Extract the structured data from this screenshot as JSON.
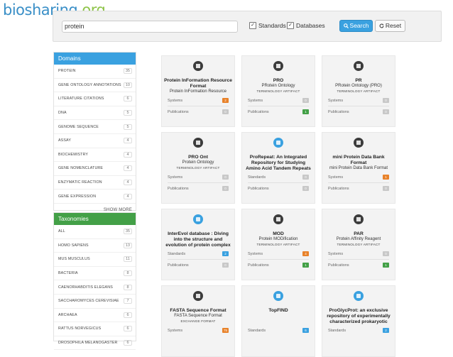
{
  "logo": {
    "text_a": "biosharing",
    "text_b": ".org"
  },
  "search": {
    "value": "protein",
    "standards_label": "Standards",
    "databases_label": "Databases",
    "check_mark": "✓",
    "search_label": "Search",
    "reset_label": "Reset",
    "search_icon": "magnifier-icon",
    "reset_icon": "refresh-icon"
  },
  "domains": {
    "title": "Domains",
    "items": [
      {
        "label": "PROTEIN",
        "count": "35"
      },
      {
        "label": "GENE ONTOLOGY ANNOTATIONS",
        "count": "10"
      },
      {
        "label": "LITERATURE CITATIONS",
        "count": "6"
      },
      {
        "label": "DNA",
        "count": "5"
      },
      {
        "label": "GENOME SEQUENCE",
        "count": "5"
      },
      {
        "label": "ASSAY",
        "count": "4"
      },
      {
        "label": "BIOCHEMISTRY",
        "count": "4"
      },
      {
        "label": "GENE NOMENCLATURE",
        "count": "4"
      },
      {
        "label": "ENZYMATIC REACTION",
        "count": "4"
      },
      {
        "label": "GENE EXPRESSION",
        "count": "4"
      }
    ],
    "show_more": "SHOW MORE"
  },
  "taxonomies": {
    "title": "Taxonomies",
    "items": [
      {
        "label": "ALL",
        "count": "35"
      },
      {
        "label": "HOMO SAPIENS",
        "count": "13"
      },
      {
        "label": "MUS MUSCULUS",
        "count": "11"
      },
      {
        "label": "BACTERIA",
        "count": "8"
      },
      {
        "label": "CAENORHABDITIS ELEGANS",
        "count": "8"
      },
      {
        "label": "SACCHAROMYCES CEREVISIAE",
        "count": "7"
      },
      {
        "label": "ARCHAEA",
        "count": "6"
      },
      {
        "label": "RATTUS NORVEGICUS",
        "count": "6"
      },
      {
        "label": "DROSOPHILA MELANOGASTER",
        "count": "6"
      }
    ]
  },
  "cards": [
    {
      "icon": "standard-icon",
      "title": "Protein InFormation Resource Format",
      "subtitle": "Protein InFormation Resource",
      "type": "",
      "stats": [
        {
          "label": "Systems",
          "value": "2",
          "color": "orange"
        },
        {
          "label": "Publications",
          "value": "0",
          "color": "grey"
        }
      ]
    },
    {
      "icon": "standard-icon",
      "title": "PRO",
      "subtitle": "PRotein Ontology",
      "type": "TERMINOLOGY ARTIFACT",
      "stats": [
        {
          "label": "Systems",
          "value": "0",
          "color": "grey"
        },
        {
          "label": "Publications",
          "value": "1",
          "color": "green"
        }
      ]
    },
    {
      "icon": "standard-icon",
      "title": "PR",
      "subtitle": "PRotein Ontology (PRO)",
      "type": "TERMINOLOGY ARTIFACT",
      "stats": [
        {
          "label": "Systems",
          "value": "0",
          "color": "grey"
        },
        {
          "label": "Publications",
          "value": "0",
          "color": "grey"
        }
      ]
    },
    {
      "icon": "standard-icon",
      "title": "PRO Ont",
      "subtitle": "Protein Ontology",
      "type": "TERMINOLOGY ARTIFACT",
      "stats": [
        {
          "label": "Systems",
          "value": "0",
          "color": "grey"
        },
        {
          "label": "Publications",
          "value": "0",
          "color": "grey"
        }
      ]
    },
    {
      "icon": "database-icon",
      "title": "ProRepeat: An Integrated Repository for Studying Amino Acid Tandem Repeats",
      "subtitle": "",
      "type": "",
      "stats": [
        {
          "label": "Standards",
          "value": "0",
          "color": "grey"
        },
        {
          "label": "Publications",
          "value": "0",
          "color": "grey"
        }
      ]
    },
    {
      "icon": "standard-icon",
      "title": "mini Protein Data Bank Format",
      "subtitle": "mini Protein Data Bank Format",
      "type": "",
      "stats": [
        {
          "label": "Systems",
          "value": "1",
          "color": "orange"
        },
        {
          "label": "Publications",
          "value": "0",
          "color": "grey"
        }
      ]
    },
    {
      "icon": "database-icon",
      "title": "InterEvol database : Diving into the structure and evolution of protein complex",
      "subtitle": "",
      "type": "",
      "stats": [
        {
          "label": "Standards",
          "value": "2",
          "color": "blue"
        },
        {
          "label": "Publications",
          "value": "0",
          "color": "grey"
        }
      ]
    },
    {
      "icon": "standard-icon",
      "title": "MOD",
      "subtitle": "Protein MODification",
      "type": "TERMINOLOGY ARTIFACT",
      "stats": [
        {
          "label": "Systems",
          "value": "4",
          "color": "orange"
        },
        {
          "label": "Publications",
          "value": "1",
          "color": "green"
        }
      ]
    },
    {
      "icon": "standard-icon",
      "title": "PAR",
      "subtitle": "Protein Affinity Reagent",
      "type": "TERMINOLOGY ARTIFACT",
      "stats": [
        {
          "label": "Systems",
          "value": "0",
          "color": "grey"
        },
        {
          "label": "Publications",
          "value": "1",
          "color": "green"
        }
      ]
    },
    {
      "icon": "standard-icon",
      "title": "FASTA Sequence Format",
      "subtitle": "FASTA Sequence Format",
      "type": "EXCHANGE FORMAT",
      "stats": [
        {
          "label": "Systems",
          "value": "75",
          "color": "orange"
        }
      ]
    },
    {
      "icon": "database-icon",
      "title": "TopFIND",
      "subtitle": "",
      "type": "",
      "stats": [
        {
          "label": "Standards",
          "value": "6",
          "color": "blue"
        }
      ]
    },
    {
      "icon": "database-icon",
      "title": "ProGlycProt: an exclusive repository of experimentally characterized prokaryotic",
      "subtitle": "",
      "type": "",
      "stats": [
        {
          "label": "Standards",
          "value": "2",
          "color": "blue"
        }
      ]
    }
  ]
}
